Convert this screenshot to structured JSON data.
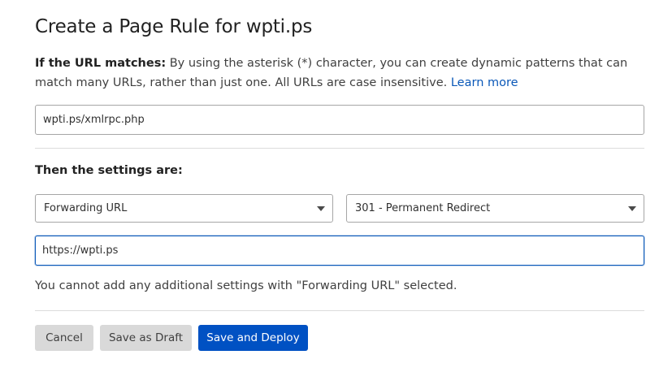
{
  "header": {
    "title": "Create a Page Rule for wpti.ps"
  },
  "url_match": {
    "label": "If the URL matches:",
    "description": " By using the asterisk (*) character, you can create dynamic patterns that can match many URLs, rather than just one. All URLs are case insensitive. ",
    "learn_more": "Learn more",
    "value": "wpti.ps/xmlrpc.php"
  },
  "settings": {
    "heading": "Then the settings are:",
    "setting_select": "Forwarding URL",
    "status_select": "301 - Permanent Redirect",
    "destination_value": "https://wpti.ps",
    "note": "You cannot add any additional settings with \"Forwarding URL\" selected."
  },
  "actions": {
    "cancel": "Cancel",
    "save_draft": "Save as Draft",
    "save_deploy": "Save and Deploy"
  },
  "colors": {
    "primary": "#0051c3",
    "link": "#0a58b8",
    "secondary_button": "#d9d9d9"
  }
}
